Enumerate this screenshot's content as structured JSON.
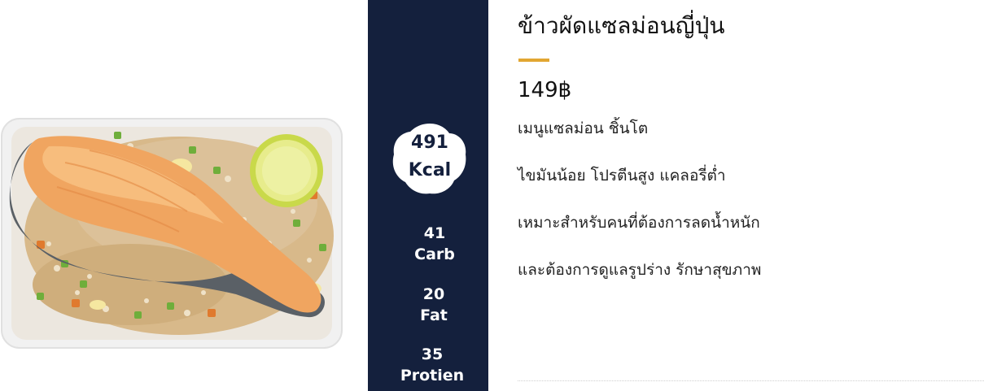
{
  "product": {
    "title": "ข้าวผัดแซลม่อนญี่ปุ่น",
    "price": "149฿",
    "description": [
      "เมนูแซลม่อน ชิ้นโต",
      "ไขมันน้อย โปรตีนสูง แคลอรี่ต่ำ",
      "เหมาะสำหรับคนที่ต้องการลดน้ำหนัก",
      "และต้องการดูแลรูปร่าง รักษาสุขภาพ"
    ]
  },
  "nutrition": {
    "kcal_value": "491",
    "kcal_unit": "Kcal",
    "carb_value": "41",
    "carb_label": "Carb",
    "fat_value": "20",
    "fat_label": "Fat",
    "protein_value": "35",
    "protein_label": "Protien"
  },
  "colors": {
    "nutrition_bg": "#14203d",
    "accent": "#e2a632",
    "text": "#111111"
  },
  "icons": {
    "kcal_badge": "cloud-badge-shape",
    "product_photo": "salmon-fried-rice-photo"
  }
}
